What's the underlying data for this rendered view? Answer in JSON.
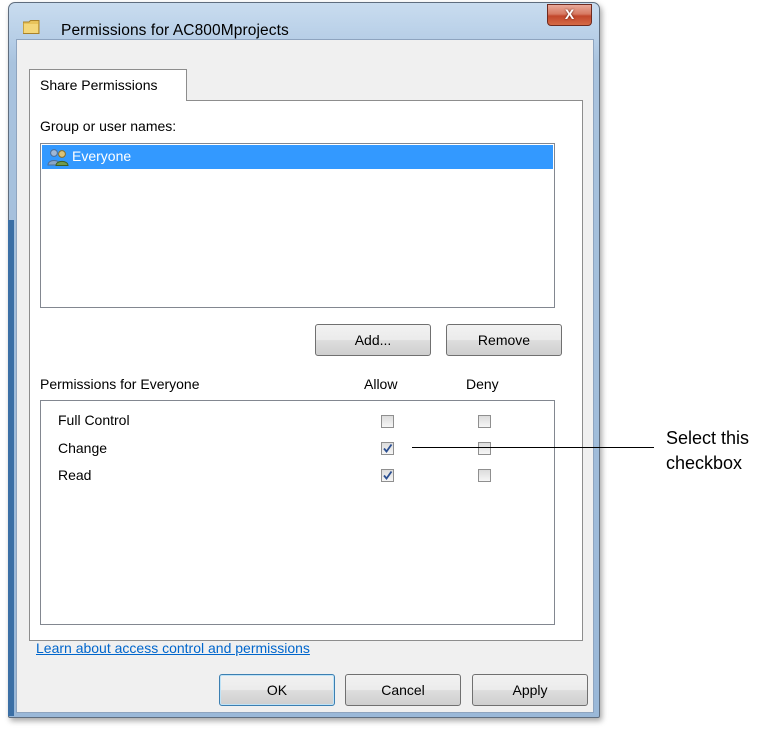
{
  "window": {
    "title": "Permissions for AC800Mprojects",
    "close_label": "X"
  },
  "tabs": [
    {
      "label": "Share Permissions",
      "selected": true
    }
  ],
  "group_section": {
    "label": "Group or user names:",
    "items": [
      {
        "name": "Everyone",
        "selected": true,
        "icon": "users-icon"
      }
    ],
    "add_label": "Add...",
    "remove_label": "Remove"
  },
  "permissions_section": {
    "label": "Permissions for Everyone",
    "allow_header": "Allow",
    "deny_header": "Deny",
    "rows": [
      {
        "name": "Full Control",
        "allow": false,
        "deny": false
      },
      {
        "name": "Change",
        "allow": true,
        "deny": false
      },
      {
        "name": "Read",
        "allow": true,
        "deny": false
      }
    ]
  },
  "help_link": "Learn about access control and permissions",
  "footer": {
    "ok_label": "OK",
    "cancel_label": "Cancel",
    "apply_label": "Apply"
  },
  "callout": {
    "line1": "Select this",
    "line2": "checkbox"
  },
  "colors": {
    "selection": "#3399ff",
    "link": "#0066cc",
    "close_button": "#c2472c",
    "frame": "#b5cde6"
  }
}
